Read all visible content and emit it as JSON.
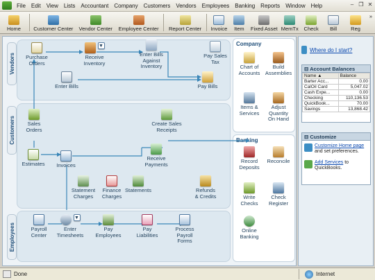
{
  "menu": [
    "File",
    "Edit",
    "View",
    "Lists",
    "Accountant",
    "Company",
    "Customers",
    "Vendors",
    "Employees",
    "Banking",
    "Reports",
    "Window",
    "Help"
  ],
  "toolbar": {
    "home": "Home",
    "customer_center": "Customer Center",
    "vendor_center": "Vendor Center",
    "employee_center": "Employee Center",
    "report_center": "Report Center",
    "invoice": "Invoice",
    "item": "Item",
    "fixed_asset": "Fixed Asset",
    "memtx": "MemTx",
    "check": "Check",
    "bill": "Bill",
    "reg": "Reg"
  },
  "sections": {
    "vendors": "Vendors",
    "customers": "Customers",
    "employees": "Employees",
    "company": "Company",
    "banking": "Banking"
  },
  "workflow": {
    "purchase_orders": "Purchase\nOrders",
    "receive_inventory": "Receive\nInventory",
    "enter_bills_against_inventory": "Enter Bills\nAgainst\nInventory",
    "pay_sales_tax": "Pay Sales\nTax",
    "enter_bills": "Enter Bills",
    "pay_bills": "Pay Bills",
    "sales_orders": "Sales\nOrders",
    "create_sales_receipts": "Create Sales\nReceipts",
    "estimates": "Estimates",
    "invoices": "Invoices",
    "receive_payments": "Receive\nPayments",
    "statement_charges": "Statement\nCharges",
    "finance_charges": "Finance\nCharges",
    "statements": "Statements",
    "refunds_credits": "Refunds\n& Credits",
    "payroll_center": "Payroll\nCenter",
    "enter_timesheets": "Enter\nTimesheets",
    "pay_employees": "Pay\nEmployees",
    "pay_liabilities": "Pay\nLiabilities",
    "process_payroll_forms": "Process\nPayroll\nForms"
  },
  "company": {
    "chart_of_accounts": "Chart of\nAccounts",
    "build_assemblies": "Build\nAssemblies",
    "items_services": "Items &\nServices",
    "adjust_quantity": "Adjust\nQuantity\nOn Hand"
  },
  "banking": {
    "record_deposits": "Record\nDeposits",
    "reconcile": "Reconcile",
    "write_checks": "Write\nChecks",
    "check_register": "Check\nRegister",
    "online_banking": "Online\nBanking"
  },
  "side": {
    "where_start": "Where do I start?",
    "balances_title": "Account Balances",
    "col_name": "Name",
    "col_balance": "Balance",
    "accounts": [
      {
        "name": "Barter Acc...",
        "balance": "0.00"
      },
      {
        "name": "CalOil Card",
        "balance": "5,047.02"
      },
      {
        "name": "Cash Expe...",
        "balance": "0.00"
      },
      {
        "name": "Checking",
        "balance": "110,136.53"
      },
      {
        "name": "QuickBook...",
        "balance": "70.00"
      },
      {
        "name": "Savings",
        "balance": "13,868.42"
      }
    ],
    "customize_title": "Customize",
    "customize_link": "Customize Home page",
    "customize_text": "and set preferences.",
    "add_services_link": "Add Services",
    "add_services_to": "to",
    "add_services_text": "QuickBooks."
  },
  "status": {
    "left": "Done",
    "right": "Internet"
  },
  "colors": {
    "accent": "#1f4e79",
    "flow": "#3a86b8"
  }
}
